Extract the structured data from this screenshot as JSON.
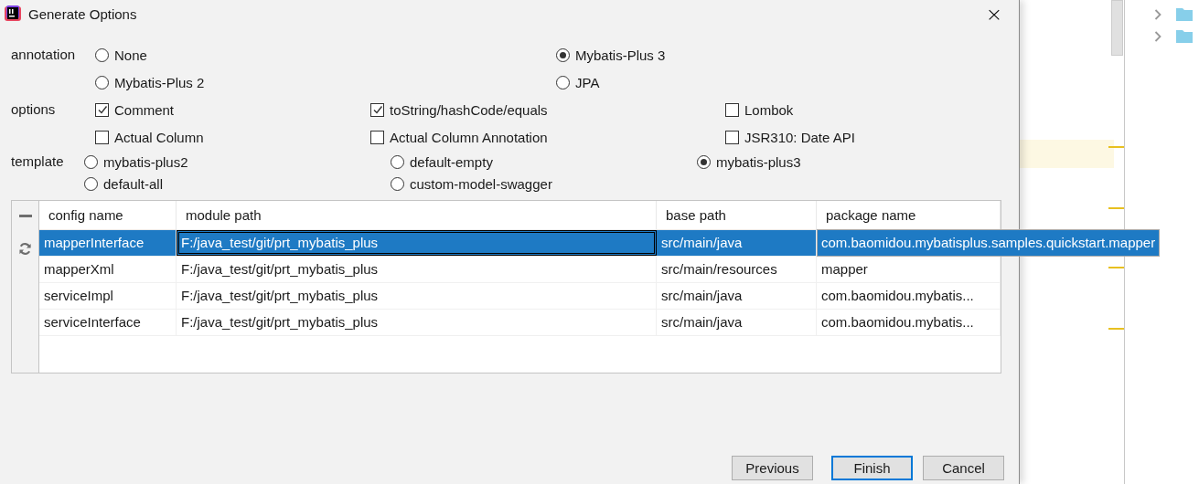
{
  "window": {
    "title": "Generate Options",
    "close": "×"
  },
  "annotation": {
    "label": "annotation",
    "options": [
      {
        "label": "None",
        "selected": false
      },
      {
        "label": "Mybatis-Plus 3",
        "selected": true
      },
      {
        "label": "Mybatis-Plus 2",
        "selected": false
      },
      {
        "label": "JPA",
        "selected": false
      }
    ]
  },
  "options": {
    "label": "options",
    "items": [
      {
        "label": "Comment",
        "checked": true
      },
      {
        "label": "toString/hashCode/equals",
        "checked": true
      },
      {
        "label": "Lombok",
        "checked": false
      },
      {
        "label": "Actual Column",
        "checked": false
      },
      {
        "label": "Actual Column Annotation",
        "checked": false
      },
      {
        "label": "JSR310: Date API",
        "checked": false
      }
    ]
  },
  "template": {
    "label": "template",
    "options": [
      {
        "label": "mybatis-plus2",
        "selected": false
      },
      {
        "label": "default-empty",
        "selected": false
      },
      {
        "label": "mybatis-plus3",
        "selected": true
      },
      {
        "label": "default-all",
        "selected": false
      },
      {
        "label": "custom-model-swagger",
        "selected": false
      }
    ]
  },
  "table": {
    "columns": [
      "config name",
      "module path",
      "base path",
      "package name"
    ],
    "rows": [
      {
        "selected": true,
        "cells": [
          {
            "text": "mapperInterface",
            "focused": false,
            "expanded": false
          },
          {
            "text": "F:/java_test/git/prt_mybatis_plus",
            "focused": true,
            "expanded": false
          },
          {
            "text": "src/main/java",
            "focused": false,
            "expanded": false
          },
          {
            "text": "com.baomidou.mybatisplus.samples.quickstart.mapper",
            "focused": false,
            "expanded": true
          }
        ]
      },
      {
        "selected": false,
        "cells": [
          {
            "text": "mapperXml",
            "focused": false,
            "expanded": false
          },
          {
            "text": "F:/java_test/git/prt_mybatis_plus",
            "focused": false,
            "expanded": false
          },
          {
            "text": "src/main/resources",
            "focused": false,
            "expanded": false
          },
          {
            "text": "mapper",
            "focused": false,
            "expanded": false
          }
        ]
      },
      {
        "selected": false,
        "cells": [
          {
            "text": "serviceImpl",
            "focused": false,
            "expanded": false
          },
          {
            "text": "F:/java_test/git/prt_mybatis_plus",
            "focused": false,
            "expanded": false
          },
          {
            "text": "src/main/java",
            "focused": false,
            "expanded": false
          },
          {
            "text": "com.baomidou.mybatis...",
            "focused": false,
            "expanded": false
          }
        ]
      },
      {
        "selected": false,
        "cells": [
          {
            "text": "serviceInterface",
            "focused": false,
            "expanded": false
          },
          {
            "text": "F:/java_test/git/prt_mybatis_plus",
            "focused": false,
            "expanded": false
          },
          {
            "text": "src/main/java",
            "focused": false,
            "expanded": false
          },
          {
            "text": "com.baomidou.mybatis...",
            "focused": false,
            "expanded": false
          }
        ]
      }
    ]
  },
  "buttons": [
    {
      "label": "Previous",
      "selected": false
    },
    {
      "label": "Finish",
      "selected": true
    },
    {
      "label": "Cancel",
      "selected": false
    }
  ]
}
